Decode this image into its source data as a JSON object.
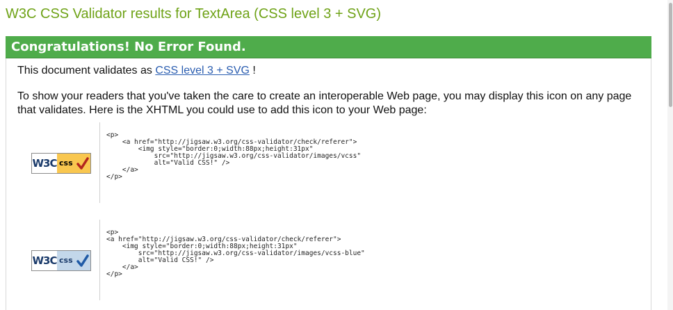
{
  "page": {
    "title": "W3C CSS Validator results for TextArea (CSS level 3 + SVG)"
  },
  "banner": {
    "text": "Congratulations! No Error Found."
  },
  "validation": {
    "prefix": "This document validates as ",
    "link_text": "CSS level 3 + SVG",
    "suffix": " !"
  },
  "instructions": {
    "text": "To show your readers that you've taken the care to create an interoperable Web page, you may display this icon on any page that validates. Here is the XHTML you could use to add this icon to your Web page:"
  },
  "badges": [
    {
      "w3c_text": "W3C",
      "css_text": "css",
      "variant": "gold",
      "code": "<p>\n    <a href=\"http://jigsaw.w3.org/css-validator/check/referer\">\n        <img style=\"border:0;width:88px;height:31px\"\n            src=\"http://jigsaw.w3.org/css-validator/images/vcss\"\n            alt=\"Valid CSS!\" />\n    </a>\n</p>"
    },
    {
      "w3c_text": "W3C",
      "css_text": "css",
      "variant": "blue",
      "code": "<p>\n<a href=\"http://jigsaw.w3.org/css-validator/check/referer\">\n    <img style=\"border:0;width:88px;height:31px\"\n        src=\"http://jigsaw.w3.org/css-validator/images/vcss-blue\"\n        alt=\"Valid CSS!\" />\n    </a>\n</p>"
    }
  ],
  "colors": {
    "title": "#6ea216",
    "banner": "#4fac4b",
    "link": "#2a5db0",
    "badge_gold": "#f9c74f",
    "badge_blue": "#c3d7ea",
    "check_red": "#b3261e",
    "check_blue": "#1f5aa6"
  },
  "icons": {
    "badge_check": "checkmark-icon"
  }
}
